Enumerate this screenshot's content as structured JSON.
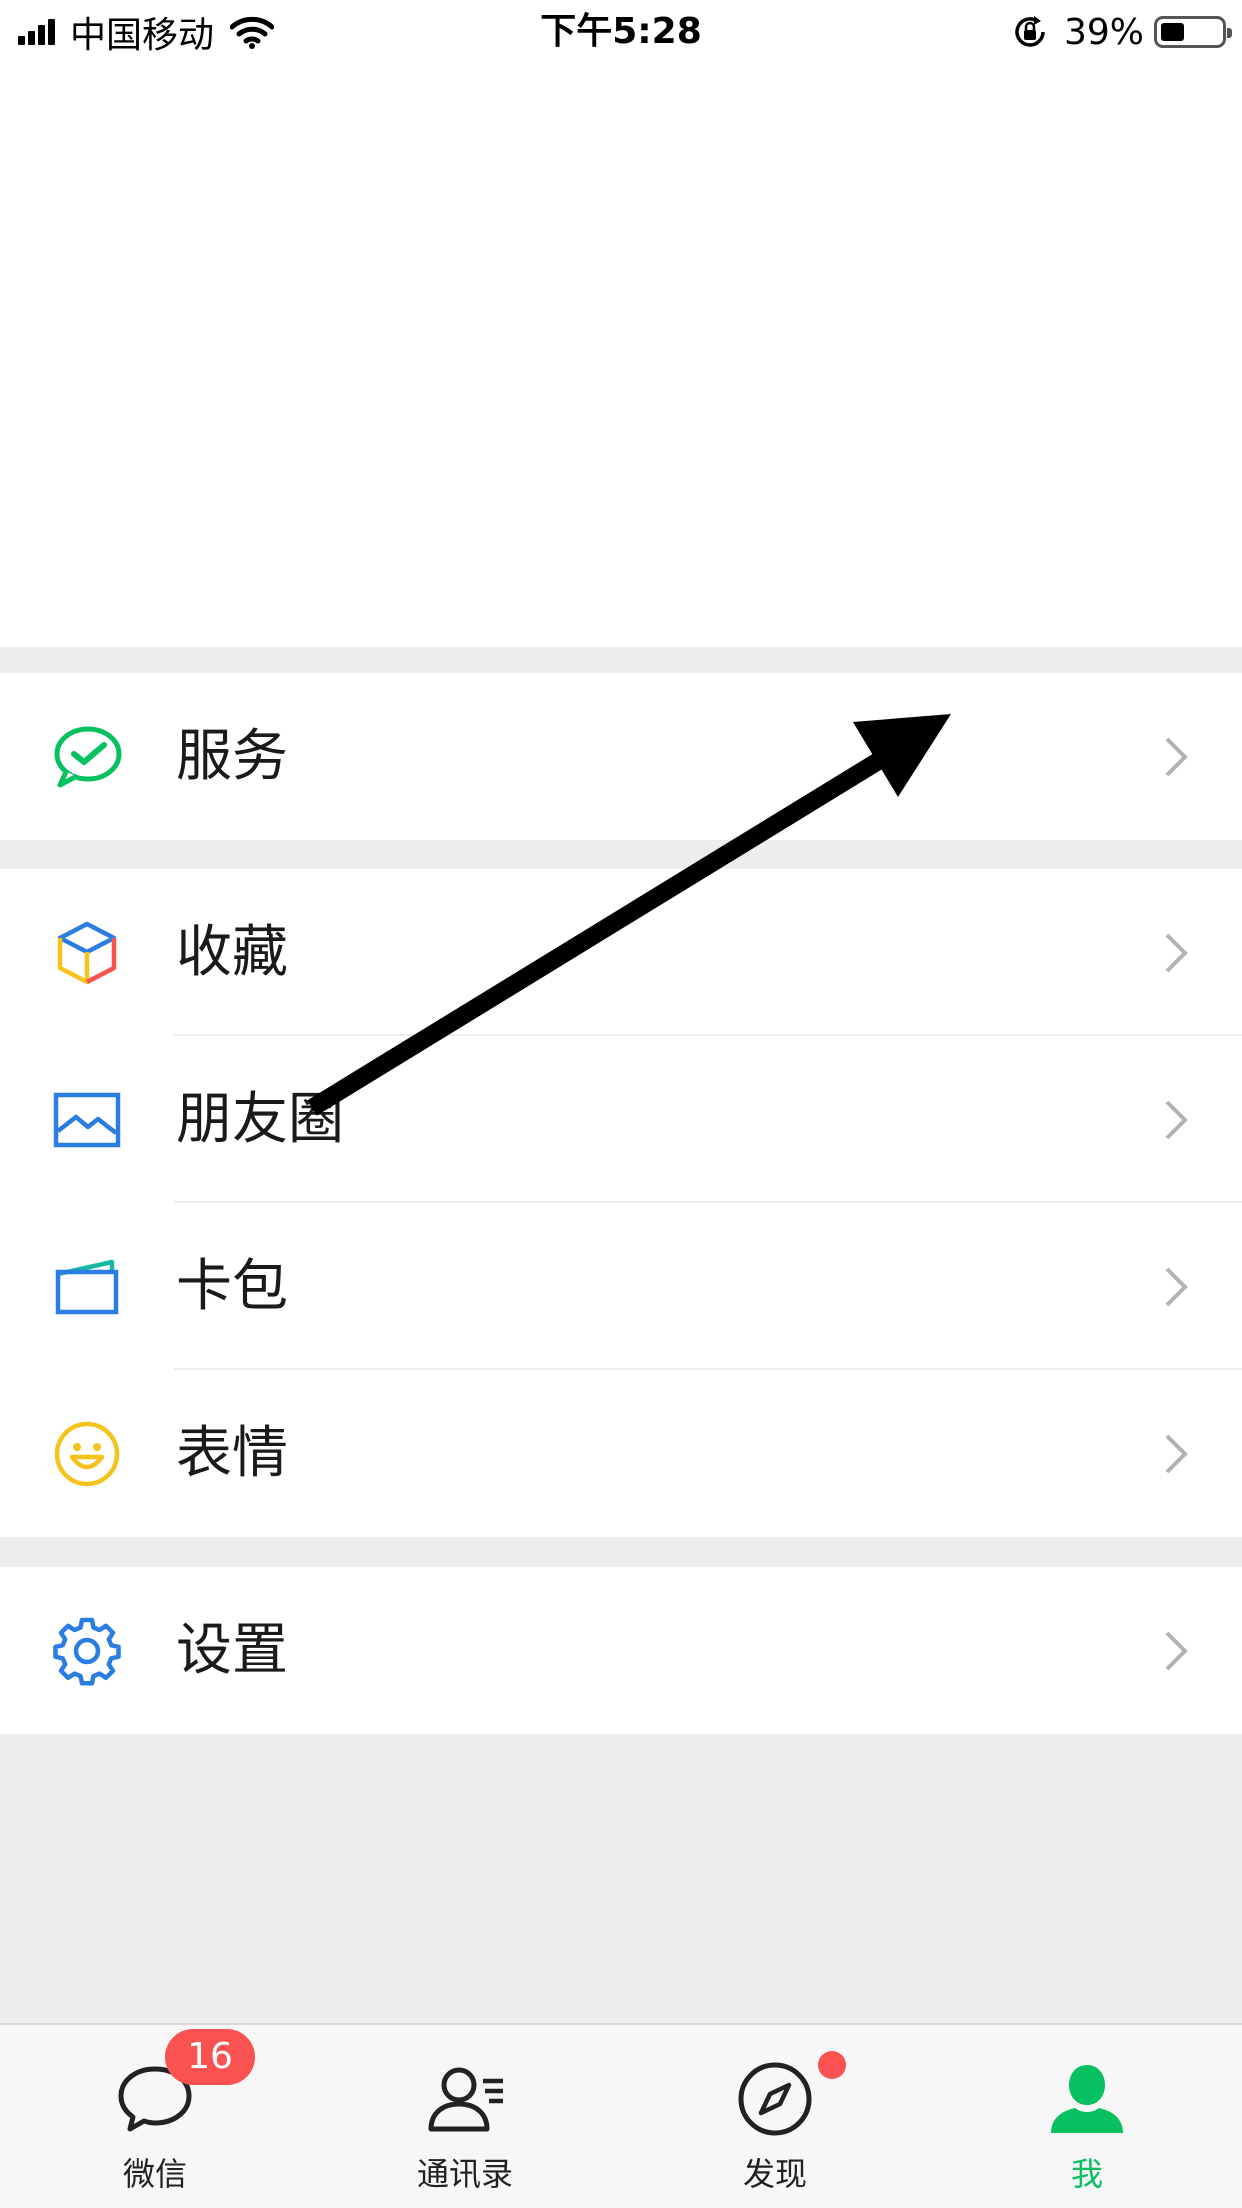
{
  "status_bar": {
    "carrier": "中国移动",
    "time": "下午5:28",
    "battery_percent": "39%",
    "battery_level": 0.39,
    "icons": [
      "signal-icon",
      "wifi-icon",
      "orientation-lock-icon",
      "battery-icon"
    ]
  },
  "menu": {
    "service": "服务",
    "favorites": "收藏",
    "moments": "朋友圈",
    "cards": "卡包",
    "stickers": "表情",
    "settings": "设置"
  },
  "tabbar": {
    "chats": "微信",
    "chats_badge": "16",
    "contacts": "通讯录",
    "discover": "发现",
    "me": "我"
  },
  "colors": {
    "accent_green": "#07c160",
    "badge_red": "#fa5151",
    "icon_blue": "#2a7de1",
    "icon_yellow": "#f6c21c",
    "page_bg": "#ededed"
  }
}
